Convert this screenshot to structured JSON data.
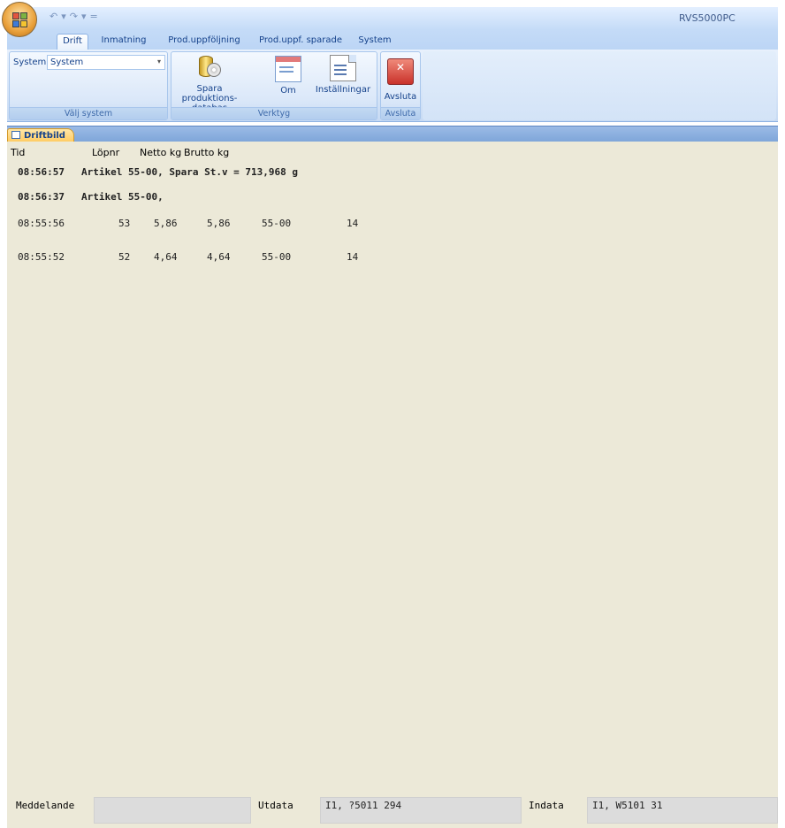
{
  "window": {
    "title": "RVS5000PC"
  },
  "qat": {
    "undo": "↶",
    "redo": "↷",
    "customize": "="
  },
  "tabs": [
    {
      "label": "Drift",
      "active": true
    },
    {
      "label": "Inmatning"
    },
    {
      "label": "Prod.uppföljning"
    },
    {
      "label": "Prod.uppf. sparade"
    },
    {
      "label": "System"
    }
  ],
  "ribbon": {
    "valj_system": {
      "label": "System",
      "value": "System",
      "group": "Välj system"
    },
    "verktyg": {
      "group": "Verktyg",
      "spara": "Spara produktions-databas",
      "om": "Om",
      "installningar": "Inställningar"
    },
    "avsluta": {
      "group": "Avsluta",
      "button": "Avsluta"
    }
  },
  "document_tab": {
    "label": "Driftbild"
  },
  "columns": {
    "tid": "Tid",
    "lopnr": "Löpnr",
    "netto": "Netto kg",
    "brutto": "Brutto kg"
  },
  "log": {
    "msg1": {
      "time": "08:56:57",
      "text": "Artikel 55-00, Spara St.v = 713,968 g"
    },
    "msg2": {
      "time": "08:56:37",
      "text": "Artikel 55-00,"
    },
    "rows": [
      {
        "time": "08:55:56",
        "lopnr": "53",
        "netto": "5,86",
        "brutto": "5,86",
        "artikel": "55-00",
        "extra": "14"
      },
      {
        "time": "08:55:52",
        "lopnr": "52",
        "netto": "4,64",
        "brutto": "4,64",
        "artikel": "55-00",
        "extra": "14"
      }
    ]
  },
  "status": {
    "meddelande_label": "Meddelande",
    "meddelande_value": "",
    "utdata_label": "Utdata",
    "utdata_value": "I1, ?5011  294",
    "indata_label": "Indata",
    "indata_value": "I1, W5101  31"
  },
  "colors": {
    "ribbon": "#d6e5f8",
    "canvas": "#ece9d8",
    "doctab": "#ffc85a",
    "text": "#15428b"
  }
}
